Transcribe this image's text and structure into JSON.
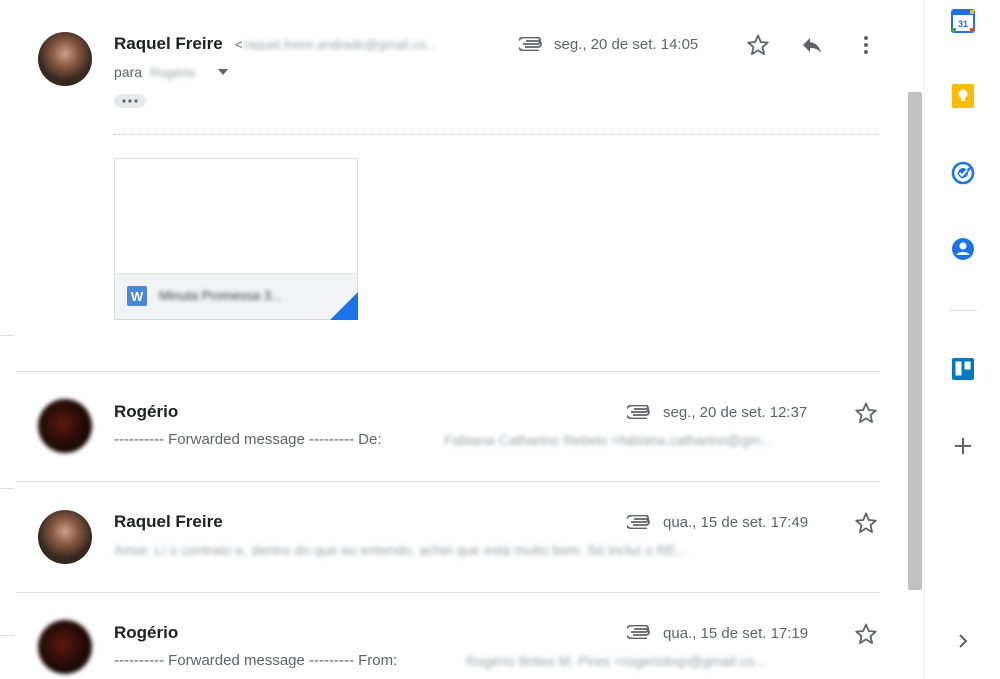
{
  "messages": [
    {
      "sender": "Raquel Freire",
      "email_prefix": "<",
      "email_redacted": "raquel.freire.andrade@gmail.co...",
      "date": "seg., 20 de set. 14:05",
      "to_label": "para",
      "to_redacted": "Rogério",
      "expanded": true,
      "attachment": {
        "type_icon": "W",
        "name": "Minuta Promessa 3..."
      }
    },
    {
      "sender": "Rogério",
      "date": "seg., 20 de set. 12:37",
      "snippet": "---------- Forwarded message --------- De:",
      "snippet_redacted": "Fabiana Catharino Rebelo <fabiana.catharino@gm..."
    },
    {
      "sender": "Raquel Freire",
      "date": "qua., 15 de set. 17:49",
      "snippet_redacted": "Amor. Li o contrato e, dentro do que eu entendo, achei que está muito bom. Só incluí o RE..."
    },
    {
      "sender": "Rogério",
      "date": "qua., 15 de set. 17:19",
      "snippet": "---------- Forwarded message --------- From:",
      "snippet_redacted": "Rogério Brites M. Pires <rogeriobsp@gmail.co..."
    }
  ],
  "icons": {
    "attachment": "paperclip-icon",
    "star": "star-outline-icon",
    "reply": "reply-icon",
    "more": "more-vert-icon",
    "expand_recipients": "caret-down-icon",
    "show_trimmed": "more-horiz-icon"
  },
  "side_panel": {
    "calendar_date": "31",
    "apps": [
      "calendar-icon",
      "keep-icon",
      "tasks-icon",
      "contacts-icon",
      "trello-icon",
      "add-icon",
      "chevron-right-icon"
    ]
  },
  "colors": {
    "calendar_blue": "#1a73e8",
    "calendar_green": "#34a853",
    "calendar_yellow": "#fbbc04",
    "calendar_red": "#ea4335",
    "keep_yellow": "#fbbc04",
    "tasks_blue": "#1a73e8",
    "contacts_blue": "#1a73e8",
    "trello_blue": "#0079bf",
    "word_blue": "#4a86d9"
  }
}
